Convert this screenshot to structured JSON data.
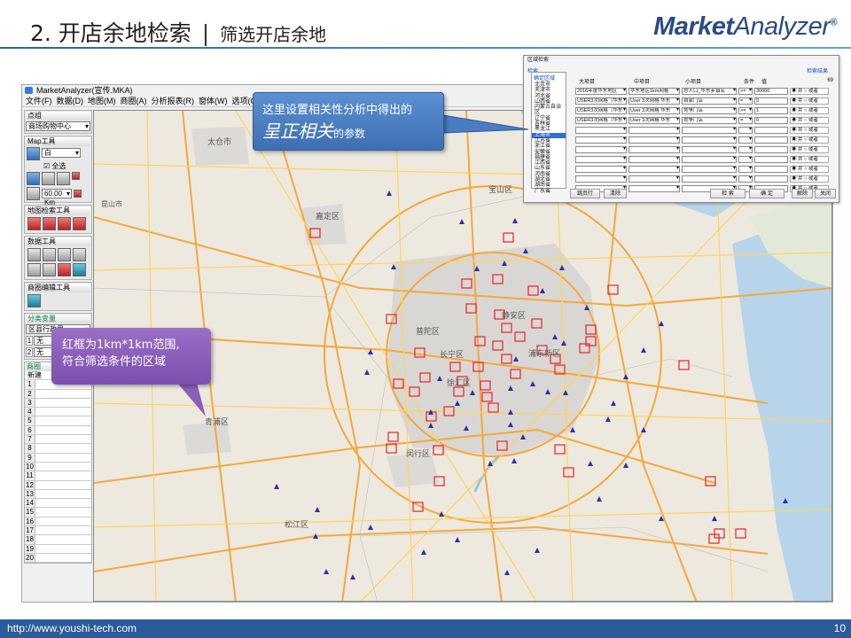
{
  "slide": {
    "title": "2. 开店余地检索",
    "separator": "|",
    "subtitle": "筛选开店余地",
    "logo_bold": "Market",
    "logo_light": "Analyzer",
    "logo_reg": "®",
    "footer_url": "http://www.youshi-tech.com",
    "page_number": "10"
  },
  "app": {
    "window_title": "MarketAnalyzer(宣传.MKA)",
    "menu": [
      "文件(F)",
      "数据(D)",
      "地图(M)",
      "商圈(A)",
      "分析报表(R)",
      "窗体(W)",
      "选项(O)",
      "帮"
    ],
    "panel": {
      "point_header": "点组",
      "point_select": "商场购物中心",
      "map_tools_header": "Map工具",
      "color_select": "白",
      "select_all": "全选",
      "scale_value": "60.00",
      "scale_unit": "Km",
      "map_search_header": "地图检索工具",
      "data_tools_header": "数据工具",
      "trade_edit_header": "商圈编辑工具",
      "var_header": "分类变量",
      "var_select": "区县行政界",
      "var1_num": "1",
      "var1_value": "无",
      "var2_num": "2",
      "var2_value": "无",
      "trade_header": "商圈",
      "new_row": "新建",
      "row_numbers": [
        "1",
        "2",
        "3",
        "4",
        "5",
        "6",
        "7",
        "8",
        "9",
        "10",
        "11",
        "12",
        "13",
        "14",
        "15",
        "16",
        "17",
        "18",
        "19",
        "20"
      ]
    },
    "map_labels": {
      "taicang": "太仓市",
      "kunshan": "昆山市",
      "baoshan": "宝山区",
      "jiading": "嘉定区",
      "putuo": "普陀区",
      "jingan": "静安区",
      "xuhui": "徐汇区",
      "pudong": "浦东新区",
      "minhang": "闵行区",
      "qingpu": "青浦区",
      "songjiang": "松江区",
      "changning": "长宁区"
    }
  },
  "dialog": {
    "title": "区域检索",
    "tab_left": "检索",
    "tab_right": "检索结果",
    "result_count": "69",
    "region_header": "确定区域",
    "regions": [
      "北京市",
      "天津市",
      "河北省",
      "山西省",
      "内蒙古自治区",
      "辽宁省",
      "吉林省",
      "黑龙江",
      "上海市",
      "江苏省",
      "浙江省",
      "安徽省",
      "福建省",
      "江西省",
      "山东省",
      "河南省",
      "湖北省",
      "湖南省",
      "广东省"
    ],
    "selected_region": "上海市",
    "col_big": "大项目",
    "col_mid": "中项目",
    "col_small": "小项目",
    "col_cond": "条件",
    "col_value": "值",
    "rows": [
      {
        "big": "2016年度华东地区",
        "mid": "华东地区1km网格",
        "small": "总人口_华东乡镇名",
        "cond": ">=",
        "value": "30000",
        "and": "并",
        "or": "或者"
      },
      {
        "big": "USER3次网格（华东",
        "mid": "User 3次网格 华东",
        "small": "自家门店",
        "cond": "=",
        "value": "0",
        "and": "并",
        "or": "或者"
      },
      {
        "big": "USER3次网格（华东",
        "mid": "User 3次网格 华东",
        "small": "竞争门店",
        "cond": ">=",
        "value": "1",
        "and": "并",
        "or": "或者"
      },
      {
        "big": "USER3次网格（华东",
        "mid": "User 3次网格 华东",
        "small": "竞争门店",
        "cond": "=",
        "value": "0",
        "and": "并",
        "or": "或者"
      }
    ],
    "empty_and": "并",
    "empty_or": "或者",
    "btn_jump": "跳页行",
    "btn_clear": "清除",
    "btn_search": "检 索",
    "btn_confirm": "确 定",
    "btn_release": "解除",
    "btn_close": "关闭"
  },
  "callouts": {
    "blue_line1": "这里设置相关性分析中得出的",
    "blue_big": "呈正相关",
    "blue_small": "的参数",
    "purple_line1": "红框为1km*1km范围,",
    "purple_line2": "符合筛选条件的区域"
  },
  "colors": {
    "footer": "#2c5a9b",
    "logo": "#2a4a86",
    "blue_callout": "#4a7cc2",
    "purple_callout": "#8a5fba",
    "grid_box": "#e8212c",
    "store_marker": "#2b2fa8",
    "road": "#f4a83a"
  }
}
